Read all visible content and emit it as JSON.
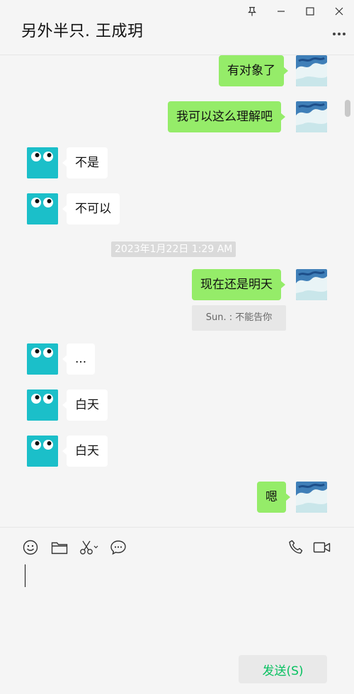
{
  "header": {
    "title": "另外半只. 王成玥"
  },
  "icons": {
    "pin": "pin-icon",
    "minimize": "minimize-icon",
    "maximize": "maximize-icon",
    "close": "close-icon",
    "more": "more-icon",
    "emoji": "emoji-icon",
    "folder": "folder-icon",
    "scissors": "scissors-icon",
    "chat_history": "chat-history-icon",
    "voice_call": "phone-icon",
    "video_call": "video-icon"
  },
  "colors": {
    "my_bubble": "#95ec69",
    "their_bubble": "#ffffff",
    "background": "#f5f5f5",
    "send_text": "#07c160",
    "avatar_teal": "#1bbfc9"
  },
  "messages": [
    {
      "sender": "me",
      "text": "有对象了"
    },
    {
      "sender": "me",
      "text": "我可以这么理解吧"
    },
    {
      "sender": "them",
      "text": "不是"
    },
    {
      "sender": "them",
      "text": "不可以"
    },
    {
      "sender": "system",
      "text": "2023年1月22日 1:29 AM"
    },
    {
      "sender": "me",
      "text": "现在还是明天"
    },
    {
      "sender": "quote",
      "text": "Sun. : 不能告你"
    },
    {
      "sender": "them",
      "text": "..."
    },
    {
      "sender": "them",
      "text": "白天"
    },
    {
      "sender": "them",
      "text": "白天"
    },
    {
      "sender": "me",
      "text": "嗯"
    }
  ],
  "input": {
    "send_label": "发送(S)"
  }
}
